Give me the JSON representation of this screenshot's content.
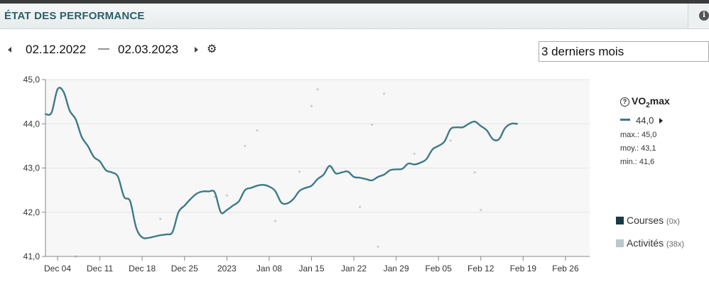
{
  "header": {
    "title": "ÉTAT DES PERFORMANCE",
    "info_icon": "info-icon"
  },
  "toolbar": {
    "start_date": "02.12.2022",
    "separator": "—",
    "end_date": "02.03.2023",
    "settings_icon": "gear-icon",
    "period_select": "3 derniers mois"
  },
  "legend": {
    "metric": {
      "base": "VO",
      "sub": "2",
      "tail": "max"
    },
    "current_value": "44,0",
    "max": "max.: 45,0",
    "avg": "moy.: 43,1",
    "min": "min.: 41,6",
    "courses": "Courses",
    "courses_count": "(0x)",
    "activities": "Activités",
    "activities_count": "(38x)",
    "colors": {
      "line": "#3e7a88",
      "courses": "#1b3a44",
      "activities": "#bcc9cc"
    }
  },
  "chart_data": {
    "type": "line",
    "x_tick_labels": [
      "Dec 04",
      "Dec 11",
      "Dec 18",
      "Dec 25",
      "2023",
      "Jan 08",
      "Jan 15",
      "Jan 22",
      "Jan 29",
      "Feb 05",
      "Feb 12",
      "Feb 19",
      "Feb 26"
    ],
    "y_tick_labels": [
      "41,0",
      "42,0",
      "43,0",
      "44,0",
      "45,0"
    ],
    "ylim": [
      41.0,
      45.0
    ],
    "xlim": [
      "2022-12-02",
      "2023-03-02"
    ],
    "grid": true,
    "legend_placement": "right",
    "series": [
      {
        "name": "VO2max",
        "color": "#3e7a88",
        "points": [
          [
            "2022-12-02",
            44.22
          ],
          [
            "2022-12-03",
            44.25
          ],
          [
            "2022-12-04",
            44.78
          ],
          [
            "2022-12-05",
            44.72
          ],
          [
            "2022-12-06",
            44.3
          ],
          [
            "2022-12-07",
            44.1
          ],
          [
            "2022-12-08",
            43.7
          ],
          [
            "2022-12-09",
            43.5
          ],
          [
            "2022-12-10",
            43.25
          ],
          [
            "2022-12-11",
            43.15
          ],
          [
            "2022-12-12",
            42.95
          ],
          [
            "2022-12-13",
            42.9
          ],
          [
            "2022-12-14",
            42.8
          ],
          [
            "2022-12-15",
            42.35
          ],
          [
            "2022-12-16",
            42.25
          ],
          [
            "2022-12-17",
            41.65
          ],
          [
            "2022-12-18",
            41.43
          ],
          [
            "2022-12-19",
            41.42
          ],
          [
            "2022-12-20",
            41.45
          ],
          [
            "2022-12-21",
            41.48
          ],
          [
            "2022-12-22",
            41.5
          ],
          [
            "2022-12-23",
            41.55
          ],
          [
            "2022-12-24",
            42.0
          ],
          [
            "2022-12-25",
            42.15
          ],
          [
            "2022-12-26",
            42.3
          ],
          [
            "2022-12-27",
            42.42
          ],
          [
            "2022-12-28",
            42.47
          ],
          [
            "2022-12-29",
            42.47
          ],
          [
            "2022-12-30",
            42.45
          ],
          [
            "2022-12-31",
            42.0
          ],
          [
            "2023-01-01",
            42.05
          ],
          [
            "2023-01-02",
            42.15
          ],
          [
            "2023-01-03",
            42.25
          ],
          [
            "2023-01-04",
            42.5
          ],
          [
            "2023-01-05",
            42.55
          ],
          [
            "2023-01-06",
            42.6
          ],
          [
            "2023-01-07",
            42.62
          ],
          [
            "2023-01-08",
            42.58
          ],
          [
            "2023-01-09",
            42.48
          ],
          [
            "2023-01-10",
            42.22
          ],
          [
            "2023-01-11",
            42.2
          ],
          [
            "2023-01-12",
            42.3
          ],
          [
            "2023-01-13",
            42.48
          ],
          [
            "2023-01-14",
            42.55
          ],
          [
            "2023-01-15",
            42.6
          ],
          [
            "2023-01-16",
            42.75
          ],
          [
            "2023-01-17",
            42.85
          ],
          [
            "2023-01-18",
            43.05
          ],
          [
            "2023-01-19",
            42.88
          ],
          [
            "2023-01-20",
            42.9
          ],
          [
            "2023-01-21",
            42.92
          ],
          [
            "2023-01-22",
            42.8
          ],
          [
            "2023-01-23",
            42.78
          ],
          [
            "2023-01-24",
            42.75
          ],
          [
            "2023-01-25",
            42.72
          ],
          [
            "2023-01-26",
            42.8
          ],
          [
            "2023-01-27",
            42.85
          ],
          [
            "2023-01-28",
            42.95
          ],
          [
            "2023-01-29",
            42.97
          ],
          [
            "2023-01-30",
            42.98
          ],
          [
            "2023-01-31",
            43.1
          ],
          [
            "2023-02-01",
            43.08
          ],
          [
            "2023-02-02",
            43.12
          ],
          [
            "2023-02-03",
            43.2
          ],
          [
            "2023-02-04",
            43.42
          ],
          [
            "2023-02-05",
            43.5
          ],
          [
            "2023-02-06",
            43.6
          ],
          [
            "2023-02-07",
            43.88
          ],
          [
            "2023-02-08",
            43.92
          ],
          [
            "2023-02-09",
            43.92
          ],
          [
            "2023-02-10",
            44.0
          ],
          [
            "2023-02-11",
            44.05
          ],
          [
            "2023-02-12",
            43.95
          ],
          [
            "2023-02-13",
            43.85
          ],
          [
            "2023-02-14",
            43.65
          ],
          [
            "2023-02-15",
            43.65
          ],
          [
            "2023-02-16",
            43.9
          ],
          [
            "2023-02-17",
            44.0
          ],
          [
            "2023-02-18",
            44.0
          ]
        ]
      },
      {
        "name": "Activités",
        "type": "scatter",
        "color": "#c8cfd0",
        "points": [
          [
            "2022-12-07",
            41.0
          ],
          [
            "2022-12-21",
            41.85
          ],
          [
            "2022-12-30",
            42.35
          ],
          [
            "2023-01-01",
            42.38
          ],
          [
            "2023-01-04",
            43.5
          ],
          [
            "2023-01-06",
            43.85
          ],
          [
            "2023-01-09",
            41.8
          ],
          [
            "2023-01-13",
            42.92
          ],
          [
            "2023-01-15",
            44.4
          ],
          [
            "2023-01-16",
            44.78
          ],
          [
            "2023-01-23",
            42.12
          ],
          [
            "2023-01-25",
            43.98
          ],
          [
            "2023-01-26",
            41.22
          ],
          [
            "2023-01-27",
            44.68
          ],
          [
            "2023-02-01",
            43.32
          ],
          [
            "2023-02-07",
            43.62
          ],
          [
            "2023-02-11",
            42.9
          ],
          [
            "2023-02-12",
            42.05
          ]
        ]
      }
    ]
  }
}
